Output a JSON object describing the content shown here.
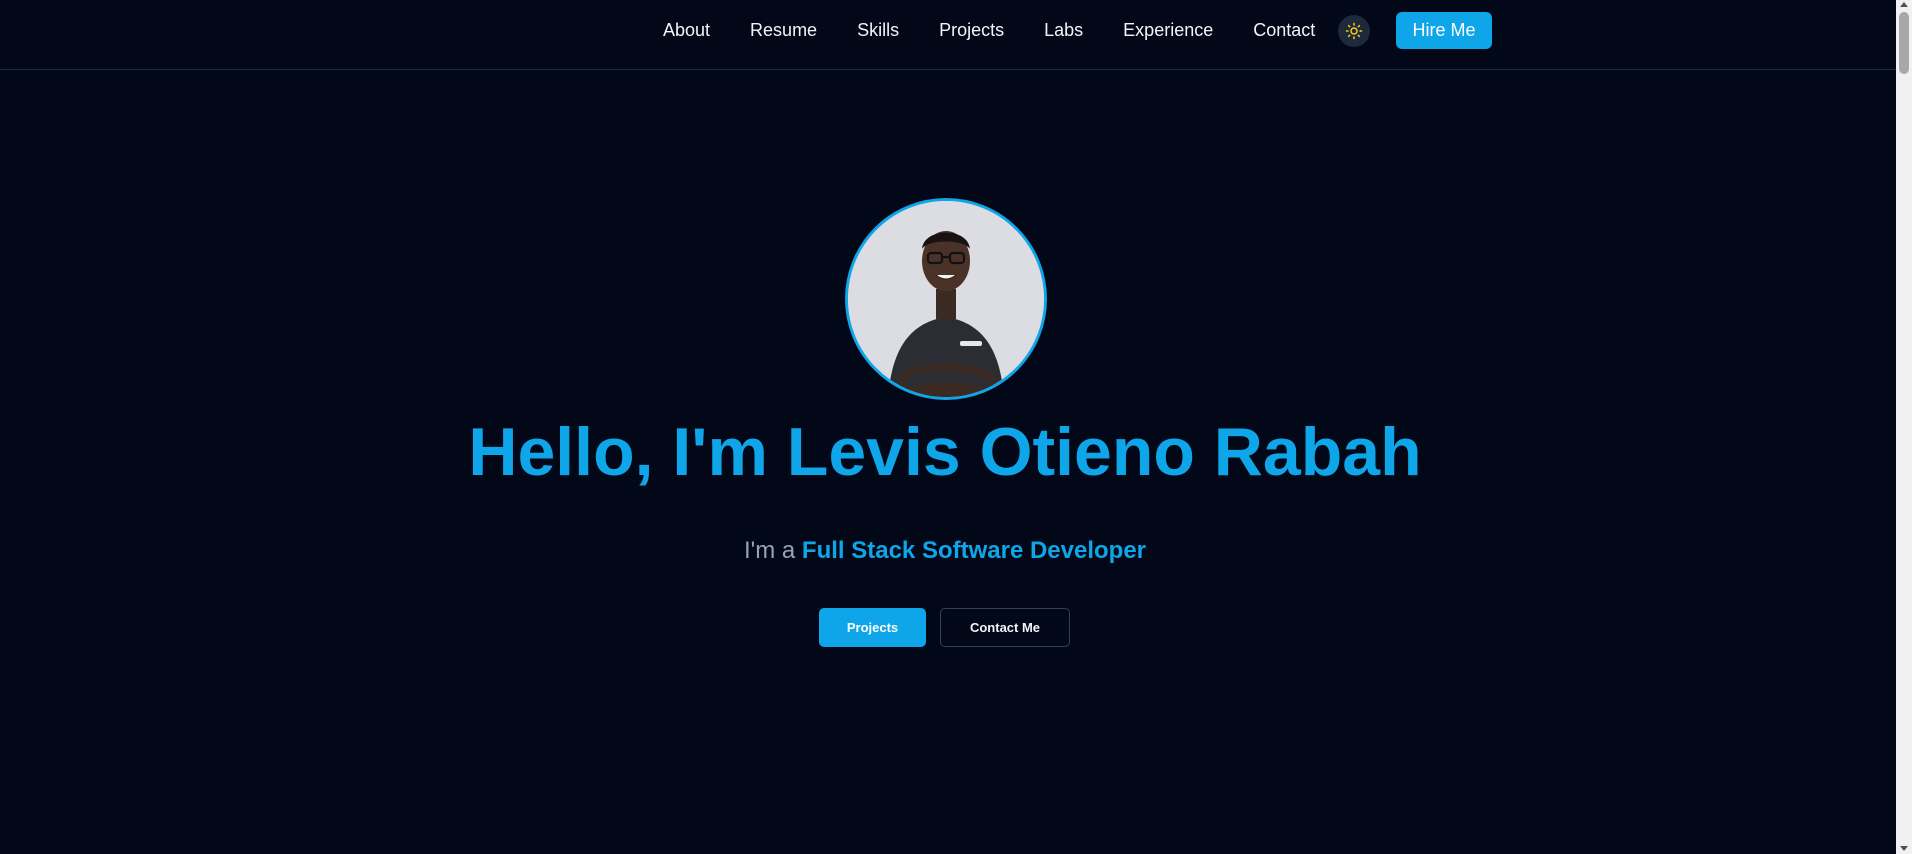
{
  "nav": {
    "links": [
      "About",
      "Resume",
      "Skills",
      "Projects",
      "Labs",
      "Experience",
      "Contact"
    ],
    "theme_toggle_icon": "sun-icon",
    "hire_label": "Hire Me"
  },
  "hero": {
    "avatar_alt": "profile-photo",
    "title": "Hello, I'm Levis Otieno Rabah",
    "subtitle_prefix": "I'm a",
    "subtitle_role": "Full Stack Software Developer",
    "primary_button": "Projects",
    "secondary_button": "Contact Me"
  },
  "colors": {
    "background": "#020817",
    "accent": "#0ea5e9",
    "muted_text": "#94a3b8",
    "nav_text": "#f1f5f9",
    "border": "#1e293b"
  }
}
